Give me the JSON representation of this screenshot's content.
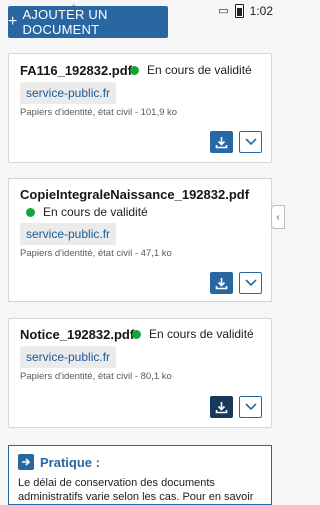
{
  "status_bar": {
    "time": "1:02",
    "icons": [
      "check-icon",
      "check-icon",
      "carrier-icon",
      "lock-icon",
      "notification-icon",
      "sim-icon",
      "battery-icon"
    ]
  },
  "add_button": {
    "label": "AJOUTER UN DOCUMENT"
  },
  "documents": [
    {
      "title": "FA116_192832.pdf",
      "status": "En cours de validité",
      "source": "service-public.fr",
      "meta": "Papiers d'identité, état civil - 101,9 ko"
    },
    {
      "title": "CopieIntegraleNaissance_192832.pdf",
      "status": "En cours de validité",
      "source": "service-public.fr",
      "meta": "Papiers d'identité, état civil - 47,1 ko"
    },
    {
      "title": "Notice_192832.pdf",
      "status": "En cours de validité",
      "source": "service-public.fr",
      "meta": "Papiers d'identité, état civil - 80,1 ko"
    }
  ],
  "info": {
    "title": "Pratique :",
    "text": "Le délai de conservation des documents administratifs varie selon les cas. Pour en savoir"
  },
  "colors": {
    "primary": "#2967a3",
    "status_ok": "#18a23b",
    "link": "#1a5a96"
  }
}
